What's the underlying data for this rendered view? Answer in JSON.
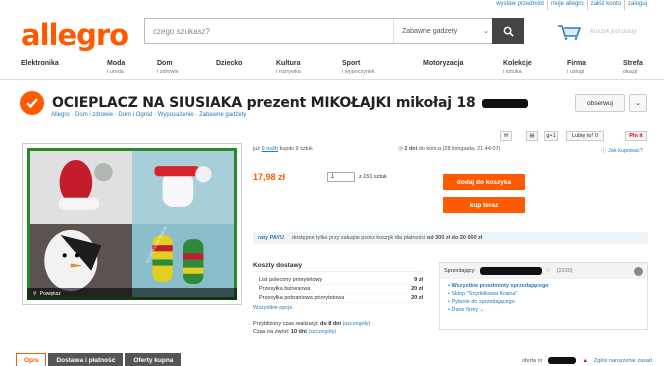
{
  "topbar": {
    "links": [
      "wystaw przedmiot",
      "moje allegro",
      "załóż konto",
      "zaloguj"
    ]
  },
  "logo": "allegro",
  "search": {
    "placeholder": "czego szukasz?",
    "category": "Zabawne gadżety"
  },
  "cart": {
    "text": "Koszyk jest pusty"
  },
  "nav": [
    {
      "label": "Elektronika",
      "sub": ""
    },
    {
      "label": "Moda",
      "sub": "i uroda"
    },
    {
      "label": "Dom",
      "sub": "i zdrowie"
    },
    {
      "label": "Dziecko",
      "sub": ""
    },
    {
      "label": "Kultura",
      "sub": "i rozrywka"
    },
    {
      "label": "Sport",
      "sub": "i wypoczynek"
    },
    {
      "label": "Motoryzacja",
      "sub": ""
    },
    {
      "label": "Kolekcje",
      "sub": "i sztuka"
    },
    {
      "label": "Firma",
      "sub": "i usługi"
    },
    {
      "label": "Strefa",
      "sub": "okazji"
    }
  ],
  "product": {
    "title": "OCIEPLACZ NA SIUSIAKA prezent MIKOŁAJKI mikołaj 18",
    "breadcrumb": [
      "Allegro",
      "Dom i zdrowie",
      "Dom i Ogród",
      "Wyposażenie",
      "Zabawne gadżety"
    ],
    "watch_label": "obserwuj",
    "zoom_label": "Powiększ",
    "photo_watermark": "szydelkowa kraina",
    "sold_prefix": "już",
    "sold_link": "9 osób",
    "sold_suffix": "kupiło 9 sztuk",
    "time_left_bold": "2 dni",
    "time_left_rest": "do końca (28 listopada, 21:44:07)",
    "questions": "Jak kupować?",
    "price": "17,98 zł",
    "qty_value": "1",
    "qty_suffix": "z 151 sztuk",
    "add_to_cart": "dodaj do koszyka",
    "buy_now": "kup teraz"
  },
  "social": {
    "gplus": "g+1",
    "like": "Lubię to!",
    "like_count": "0",
    "pinit": "Pin it"
  },
  "payband": {
    "brand": "raty PAYU",
    "text": "dostępne tylko przy zakupie przez koszyk dla płatności",
    "range": "od 300 zł do 20 000 zł"
  },
  "shipping": {
    "title": "Koszty dostawy",
    "rows": [
      {
        "name": "List polecony priorytetowy",
        "price": "9 zł"
      },
      {
        "name": "Przesyłka biznesowa",
        "price": "20 zł"
      },
      {
        "name": "Przesyłka pobraniowa priorytetowa",
        "price": "20 zł"
      }
    ],
    "all_options": "Wszystkie opcje",
    "prep_label": "Przybliżony czas realizacji:",
    "prep_value": "do 8 dni",
    "prep_link": "(szczegóły)",
    "return_label": "Czas na zwrot:",
    "return_value": "10 dni",
    "return_link": "(szczegóły)"
  },
  "seller": {
    "label": "Sprzedający:",
    "rating": "(2230)",
    "links": [
      "Wszystkie przedmioty sprzedającego",
      "Sklep \"Szydełkowa Kraina\"",
      "Pytanie do sprzedającego",
      "Dane firmy"
    ]
  },
  "tabs": [
    "Opis",
    "Dostawa i płatność",
    "Oferty kupna"
  ],
  "footer": {
    "offer_prefix": "oferta nr",
    "report": "Zgłoś naruszenie zasad"
  },
  "colors": {
    "brand": "#ff5a00",
    "link": "#2a7bbb",
    "frame": "#2a8a2a"
  }
}
